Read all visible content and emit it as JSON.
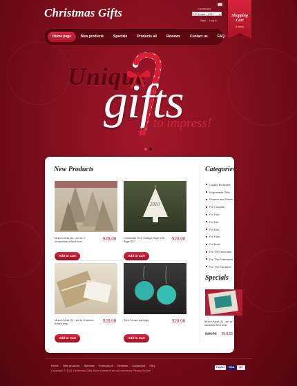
{
  "header": {
    "logo": "Christmas Gifts",
    "currency_label": "Currencies",
    "currency_value": "US Dollar - USD",
    "account_links": [
      "Sign",
      "Log in"
    ]
  },
  "cart": {
    "title": "Shopping Cart",
    "status": "0 Items"
  },
  "nav": {
    "items": [
      "Home page",
      "New products",
      "Specials",
      "Products all",
      "Reviews",
      "Contact us",
      "FAQ"
    ],
    "active_index": 0
  },
  "banner": {
    "word1": "Unique",
    "word2": "gifts",
    "word3": "to impress!",
    "slides": 2,
    "active_slide": 1
  },
  "new_products": {
    "title": "New Products",
    "items": [
      {
        "name": "Mum's Nest (3) - set of 3 ornaments in bird nest",
        "price": "$28.00",
        "button": "Add to Cart"
      },
      {
        "name": "Christmas Tree Vintage Style Gift Tags SET",
        "price": "$28.00",
        "button": "Add to Cart"
      },
      {
        "name": "Mum's Nest (3) - set of 3 stones in bird nest",
        "price": "$28.00",
        "button": "Add to Cart"
      },
      {
        "name": "Tree Crown earrings",
        "price": "$28.00",
        "button": "Add to Cart"
      }
    ]
  },
  "categories": {
    "title": "Categories",
    "items": [
      "Cookie Bouquets",
      "Engravable Gifts",
      "Flowers and Plants",
      "For Couples",
      "For Dad",
      "For Her",
      "For Him",
      "For Kids",
      "For Mom",
      "For The Decorator",
      "For The Entertainer",
      "For The Gardener"
    ]
  },
  "specials": {
    "title": "Specials",
    "name": "Mum's Nest (3) - set of 3 stones in bird nest",
    "old_price": "$28.00",
    "new_price": "$18.00"
  },
  "footer": {
    "links": [
      "Home",
      "New products",
      "Specials",
      "Products all",
      "Reviews",
      "Contact us",
      "FAQ"
    ],
    "copyright": "Copyright © 2011",
    "store_name": "Christmas Gifts Store",
    "powered_by": "Powered by",
    "powered_link": "osCommerce",
    "privacy": "Privacy Notice",
    "payments": [
      "PayPal",
      "VISA",
      "MC"
    ]
  },
  "colors": {
    "accent": "#b3162b",
    "background": "#6e0a16",
    "nav": "#5d0711",
    "button": "#c41e36"
  },
  "icons": [
    "candy-cane-icon",
    "flag-icon",
    "dropdown-arrow-icon",
    "bullet-icon",
    "paypal-icon",
    "visa-icon",
    "mastercard-icon"
  ]
}
